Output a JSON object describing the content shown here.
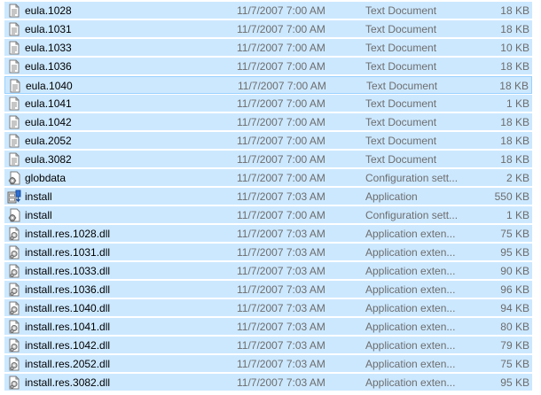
{
  "files": [
    {
      "name": "eula.1028",
      "date": "11/7/2007 7:00 AM",
      "type": "Text Document",
      "size": "18 KB",
      "icon": "text-document-icon"
    },
    {
      "name": "eula.1031",
      "date": "11/7/2007 7:00 AM",
      "type": "Text Document",
      "size": "18 KB",
      "icon": "text-document-icon"
    },
    {
      "name": "eula.1033",
      "date": "11/7/2007 7:00 AM",
      "type": "Text Document",
      "size": "10 KB",
      "icon": "text-document-icon"
    },
    {
      "name": "eula.1036",
      "date": "11/7/2007 7:00 AM",
      "type": "Text Document",
      "size": "18 KB",
      "icon": "text-document-icon"
    },
    {
      "name": "eula.1040",
      "date": "11/7/2007 7:00 AM",
      "type": "Text Document",
      "size": "18 KB",
      "icon": "text-document-icon"
    },
    {
      "name": "eula.1041",
      "date": "11/7/2007 7:00 AM",
      "type": "Text Document",
      "size": "1 KB",
      "icon": "text-document-icon"
    },
    {
      "name": "eula.1042",
      "date": "11/7/2007 7:00 AM",
      "type": "Text Document",
      "size": "18 KB",
      "icon": "text-document-icon"
    },
    {
      "name": "eula.2052",
      "date": "11/7/2007 7:00 AM",
      "type": "Text Document",
      "size": "18 KB",
      "icon": "text-document-icon"
    },
    {
      "name": "eula.3082",
      "date": "11/7/2007 7:00 AM",
      "type": "Text Document",
      "size": "18 KB",
      "icon": "text-document-icon"
    },
    {
      "name": "globdata",
      "date": "11/7/2007 7:00 AM",
      "type": "Configuration sett...",
      "size": "2 KB",
      "icon": "config-settings-icon"
    },
    {
      "name": "install",
      "date": "11/7/2007 7:03 AM",
      "type": "Application",
      "size": "550 KB",
      "icon": "installer-app-icon"
    },
    {
      "name": "install",
      "date": "11/7/2007 7:00 AM",
      "type": "Configuration sett...",
      "size": "1 KB",
      "icon": "config-settings-icon"
    },
    {
      "name": "install.res.1028.dll",
      "date": "11/7/2007 7:03 AM",
      "type": "Application exten...",
      "size": "75 KB",
      "icon": "dll-file-icon"
    },
    {
      "name": "install.res.1031.dll",
      "date": "11/7/2007 7:03 AM",
      "type": "Application exten...",
      "size": "95 KB",
      "icon": "dll-file-icon"
    },
    {
      "name": "install.res.1033.dll",
      "date": "11/7/2007 7:03 AM",
      "type": "Application exten...",
      "size": "90 KB",
      "icon": "dll-file-icon"
    },
    {
      "name": "install.res.1036.dll",
      "date": "11/7/2007 7:03 AM",
      "type": "Application exten...",
      "size": "96 KB",
      "icon": "dll-file-icon"
    },
    {
      "name": "install.res.1040.dll",
      "date": "11/7/2007 7:03 AM",
      "type": "Application exten...",
      "size": "94 KB",
      "icon": "dll-file-icon"
    },
    {
      "name": "install.res.1041.dll",
      "date": "11/7/2007 7:03 AM",
      "type": "Application exten...",
      "size": "80 KB",
      "icon": "dll-file-icon"
    },
    {
      "name": "install.res.1042.dll",
      "date": "11/7/2007 7:03 AM",
      "type": "Application exten...",
      "size": "79 KB",
      "icon": "dll-file-icon"
    },
    {
      "name": "install.res.2052.dll",
      "date": "11/7/2007 7:03 AM",
      "type": "Application exten...",
      "size": "75 KB",
      "icon": "dll-file-icon"
    },
    {
      "name": "install.res.3082.dll",
      "date": "11/7/2007 7:03 AM",
      "type": "Application exten...",
      "size": "95 KB",
      "icon": "dll-file-icon"
    }
  ],
  "focused_index": 4,
  "colors": {
    "selection": "#cce8ff",
    "focus_border": "#99d1ff",
    "secondary_text": "#6d6d6d"
  }
}
